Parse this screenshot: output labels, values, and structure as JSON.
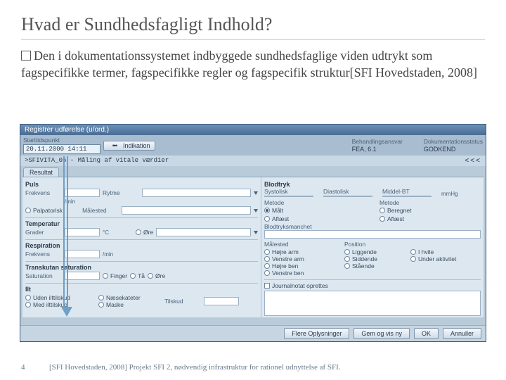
{
  "slide": {
    "title": "Hvad er Sundhedsfagligt Indhold?",
    "bullet_prefix": "Den",
    "body": " i dokumentationssystemet indbyggede sundhedsfaglige viden udtrykt som fagspecifikke termer, fagspecifikke regler og fagspecifik struktur[SFI Hovedstaden, 2008]",
    "page_number": "4",
    "footnote": "[SFI Hovedstaden, 2008] Projekt SFI 2, nødvendig infrastruktur for rationel udnyttelse af SFI."
  },
  "app": {
    "window_title": "Registrer udførelse (u/ord.)",
    "behandl_label": "Behandlingsansvar",
    "behandl_value": "FEA, 6.1",
    "dokstatus_label": "Dokumentationsstatus",
    "dokstatus_value": "GODKEND",
    "starttid_label": "Starttidspunkt",
    "starttid_value": "20.11.2000 14:11",
    "indikation_btn": "Indikation",
    "breadcrumb": ">SFIVITA_05 - Måling af vitale værdier",
    "chevrons": "<<<",
    "tabs": {
      "resultat": "Resultat"
    },
    "left": {
      "puls": {
        "title": "Puls",
        "frekvens": "Frekvens",
        "rytme": "Rytme",
        "unit": "/min",
        "palp": "Palpatorisk",
        "malested": "Målested"
      },
      "temperatur": {
        "title": "Temperatur",
        "grader": "Grader",
        "celsius": "°C",
        "ore": "Øre"
      },
      "respiration": {
        "title": "Respiration",
        "frekvens": "Frekvens",
        "unit": "/min"
      },
      "saturation": {
        "title": "Transkutan saturation",
        "sat": "Saturation",
        "finger": "Finger",
        "taa": "Tå",
        "ore": "Øre"
      },
      "ilt": {
        "title": "Ilt",
        "med": "Med ilttilskud",
        "uden": "Uden ilttilskud",
        "naese": "Næsekateter",
        "maske": "Maske",
        "tilskud": "Tilskud"
      }
    },
    "right": {
      "blodtryk": {
        "title": "Blodtryk",
        "systolisk": "Systolisk",
        "diastolisk": "Diastolisk",
        "middel": "Middel-BT",
        "mmhg": "mmHg"
      },
      "metode": {
        "title": "Metode",
        "maalt": "Målt",
        "aflaest": "Aflæst",
        "title2": "Metode",
        "beregnet": "Beregnet",
        "aflaest2": "Aflæst"
      },
      "manchet": {
        "title": "Blodtryksmanchet"
      },
      "maalested": {
        "title": "Målested",
        "hojre_arm": "Højre arm",
        "venstre_arm": "Venstre arm",
        "hojre_ben": "Højre ben",
        "venstre_ben": "Venstre ben"
      },
      "position": {
        "title": "Position",
        "liggende": "Liggende",
        "siddende": "Siddende",
        "staaende": "Stående",
        "hvile": "I hvile",
        "aktivitet": "Under aktivitet"
      },
      "journal_chk": "Journalnotat oprettes"
    },
    "buttons": {
      "flere": "Flere Oplysninger",
      "gem": "Gem og vis ny",
      "ok": "OK",
      "annuller": "Annuller"
    }
  }
}
